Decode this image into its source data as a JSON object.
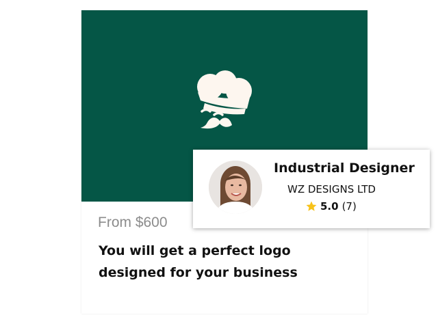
{
  "gig": {
    "price": "From $600",
    "title": "You will get a perfect logo designed for your business",
    "hero_color": "#055646",
    "hero_icon": "chef-hat-mustache-icon"
  },
  "seller": {
    "name": "Industrial Designer",
    "company": "WZ DESIGNS LTD",
    "rating": "5.0",
    "reviews": "(7)",
    "star_color": "#f7c21a"
  }
}
